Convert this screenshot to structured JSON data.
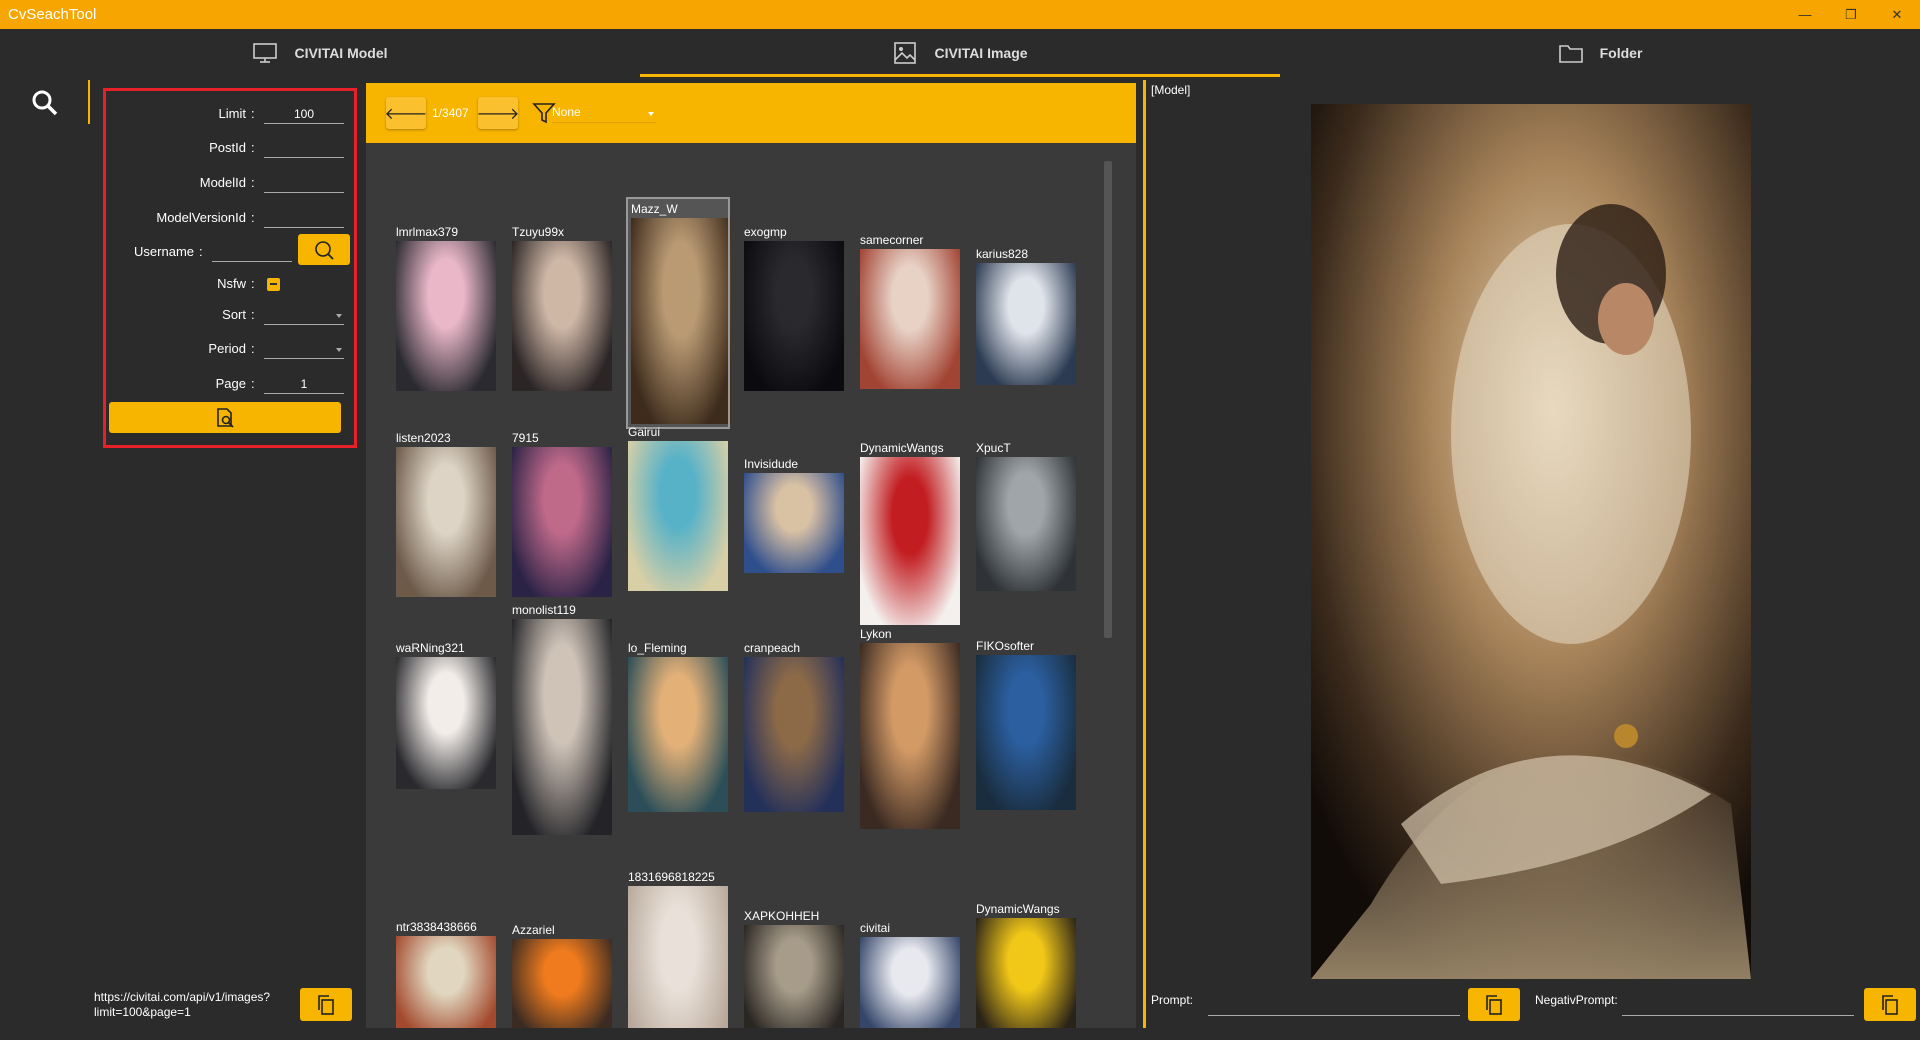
{
  "app": {
    "title": "CvSeachTool"
  },
  "tabs": [
    {
      "label": "CIVITAI Model",
      "icon": "monitor-icon",
      "active": false
    },
    {
      "label": "CIVITAI Image",
      "icon": "image-icon",
      "active": true
    },
    {
      "label": "Folder",
      "icon": "folder-icon",
      "active": false
    }
  ],
  "form": {
    "limit_label": "Limit",
    "limit_value": "100",
    "postid_label": "PostId",
    "postid_value": "",
    "modelid_label": "ModelId",
    "modelid_value": "",
    "modelversionid_label": "ModelVersionId",
    "modelversionid_value": "",
    "username_label": "Username",
    "username_value": "",
    "nsfw_label": "Nsfw",
    "sort_label": "Sort",
    "sort_value": "",
    "period_label": "Period",
    "period_value": "",
    "page_label": "Page",
    "page_value": "1",
    "colon": ":"
  },
  "url": "https://civitai.com/api/v1/images?limit=100&page=1",
  "toolbar": {
    "page_indicator": "1/3407",
    "filter_value": "None"
  },
  "images": [
    {
      "user": "lmrlmax379",
      "tone": [
        "#e9b7c8",
        "#2a2a30"
      ]
    },
    {
      "user": "Tzuyu99x",
      "tone": [
        "#cfb7a6",
        "#2b2526"
      ]
    },
    {
      "user": "Mazz_W",
      "tone": [
        "#b99a73",
        "#3d2b1c"
      ]
    },
    {
      "user": "exogmp",
      "tone": [
        "#2a2a2e",
        "#0b0b0f"
      ]
    },
    {
      "user": "samecorner",
      "tone": [
        "#e8d2c6",
        "#a24434"
      ]
    },
    {
      "user": "karius828",
      "tone": [
        "#dfe3ea",
        "#2c3b52"
      ]
    },
    {
      "user": "listen2023",
      "tone": [
        "#ddd4c6",
        "#6d5a49"
      ]
    },
    {
      "user": "7915",
      "tone": [
        "#c06a8a",
        "#2b2346"
      ]
    },
    {
      "user": "Gairui",
      "tone": [
        "#57b2c8",
        "#d8cfa6"
      ]
    },
    {
      "user": "Invisidude",
      "tone": [
        "#d9c1a4",
        "#2f4e8c"
      ]
    },
    {
      "user": "DynamicWangs",
      "tone": [
        "#c21e22",
        "#f4f0ee"
      ]
    },
    {
      "user": "XpucT",
      "tone": [
        "#9fa5a9",
        "#2f3337"
      ]
    },
    {
      "user": "waRNing321",
      "tone": [
        "#f2ede9",
        "#2a2a2e"
      ]
    },
    {
      "user": "monolist119",
      "tone": [
        "#cfc3b8",
        "#242428"
      ]
    },
    {
      "user": "lo_Fleming",
      "tone": [
        "#e3b178",
        "#2b4e58"
      ]
    },
    {
      "user": "cranpeach",
      "tone": [
        "#8c6a48",
        "#23305a"
      ]
    },
    {
      "user": "Lykon",
      "tone": [
        "#d39a66",
        "#3a2a22"
      ]
    },
    {
      "user": "FIKOsofter",
      "tone": [
        "#2b5fa0",
        "#1a2d3e"
      ]
    },
    {
      "user": "ntr3838438666",
      "tone": [
        "#e1d7c0",
        "#a34a2e"
      ]
    },
    {
      "user": "Azzariel",
      "tone": [
        "#ef7b1e",
        "#3b2b22"
      ]
    },
    {
      "user": "1831696818225",
      "tone": [
        "#e9e1d9",
        "#b8a89a"
      ]
    },
    {
      "user": "XAPKOHHEH",
      "tone": [
        "#a79c8a",
        "#2a2622"
      ]
    },
    {
      "user": "civitai",
      "tone": [
        "#e8e9ef",
        "#35466a"
      ]
    },
    {
      "user": "DynamicWangs",
      "tone": [
        "#f2c818",
        "#2a2318"
      ]
    }
  ],
  "preview": {
    "label": "[Model]"
  },
  "bottom": {
    "prompt_label": "Prompt:",
    "negative_label": "NegativPrompt:"
  },
  "colors": {
    "accent": "#f7b500",
    "titlebar": "#f7a500",
    "bg": "#2b2b2b",
    "panel": "#3a3a3a",
    "highlight_border": "#e8202a"
  }
}
